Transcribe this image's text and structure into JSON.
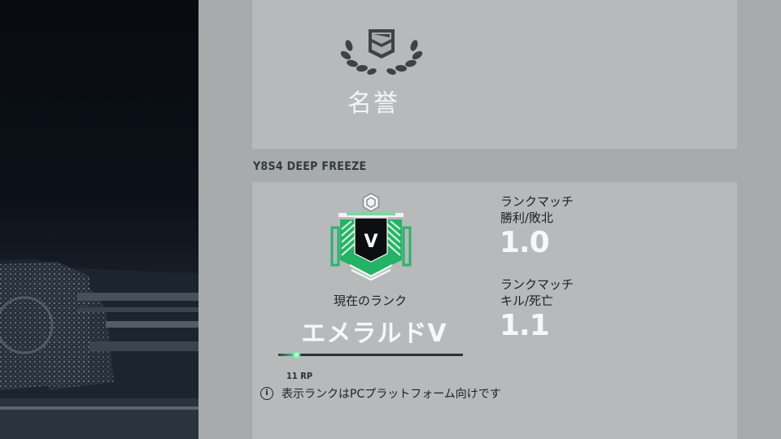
{
  "prestige": {
    "title": "名誉",
    "icon": "laurel-flag-icon"
  },
  "season": {
    "label": "Y8S4 DEEP FREEZE"
  },
  "rank": {
    "current_label": "現在のランク",
    "name": "エメラルドV",
    "badge_letter": "V",
    "badge_icon": "emerald-rank-badge-icon",
    "rp_value": "11 RP",
    "rp_progress": 0.1,
    "accent_color": "#2fc77a"
  },
  "stats": [
    {
      "label_line1": "ランクマッチ",
      "label_line2": "勝利/敗北",
      "value": "1.0"
    },
    {
      "label_line1": "ランクマッチ",
      "label_line2": "キル/死亡",
      "value": "1.1"
    }
  ],
  "notice": {
    "icon": "info-icon",
    "text": "表示ランクはPCプラットフォーム向けです"
  }
}
